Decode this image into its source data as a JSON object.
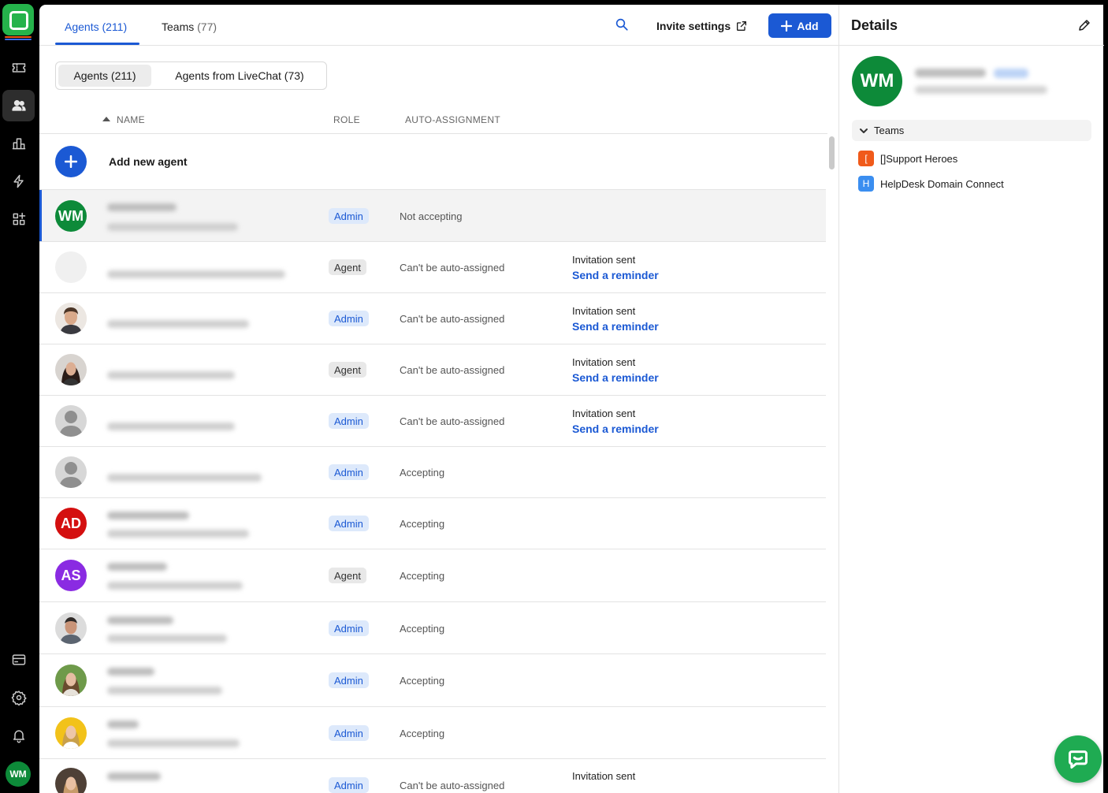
{
  "colors": {
    "accent": "#1b59d4",
    "brand_green": "#25b34b",
    "admin_badge_bg": "#dde9fb",
    "agent_badge_bg": "#e8e8e8"
  },
  "rail": {
    "items": [
      {
        "name": "tickets-icon",
        "active": false
      },
      {
        "name": "agents-icon",
        "active": true
      },
      {
        "name": "reports-icon",
        "active": false
      },
      {
        "name": "automation-icon",
        "active": false
      },
      {
        "name": "apps-icon",
        "active": false
      }
    ],
    "bottom": [
      "billing-icon",
      "settings-icon",
      "notifications-icon"
    ],
    "user_initials": "WM"
  },
  "tabs": [
    {
      "label": "Agents",
      "count": "(211)",
      "active": true
    },
    {
      "label": "Teams",
      "count": "(77)",
      "active": false
    }
  ],
  "header": {
    "invite_label": "Invite settings",
    "add_label": "Add"
  },
  "segmented": [
    {
      "label": "Agents (211)",
      "active": true
    },
    {
      "label": "Agents from LiveChat (73)",
      "active": false
    }
  ],
  "columns": {
    "name": "NAME",
    "role": "ROLE",
    "auto_assignment": "AUTO-ASSIGNMENT"
  },
  "add_agent_label": "Add new agent",
  "rows": [
    {
      "avatar": "WM",
      "avatar_color": "#0d8a39",
      "role": "Admin",
      "assignment": "Not accepting",
      "invitation": false,
      "selected": true
    },
    {
      "avatar": "",
      "avatar_color": "#f0f0f0",
      "role": "Agent",
      "assignment": "Can't be auto-assigned",
      "invitation": true
    },
    {
      "avatar": "photo-man-1",
      "role": "Admin",
      "assignment": "Can't be auto-assigned",
      "invitation": true
    },
    {
      "avatar": "photo-woman-1",
      "role": "Agent",
      "assignment": "Can't be auto-assigned",
      "invitation": true
    },
    {
      "avatar": "photo-placeholder",
      "role": "Admin",
      "assignment": "Can't be auto-assigned",
      "invitation": true
    },
    {
      "avatar": "photo-placeholder",
      "role": "Admin",
      "assignment": "Accepting",
      "invitation": false
    },
    {
      "avatar": "AD",
      "avatar_color": "#d40f0f",
      "role": "Admin",
      "assignment": "Accepting",
      "invitation": false
    },
    {
      "avatar": "AS",
      "avatar_color": "#8a2be2",
      "role": "Agent",
      "assignment": "Accepting",
      "invitation": false
    },
    {
      "avatar": "photo-man-2",
      "role": "Admin",
      "assignment": "Accepting",
      "invitation": false
    },
    {
      "avatar": "photo-woman-2",
      "role": "Admin",
      "assignment": "Accepting",
      "invitation": false
    },
    {
      "avatar": "photo-woman-3",
      "role": "Admin",
      "assignment": "Accepting",
      "invitation": false
    },
    {
      "avatar": "photo-woman-4",
      "role": "Admin",
      "assignment": "Can't be auto-assigned",
      "invitation": true
    }
  ],
  "invitation": {
    "sent_label": "Invitation sent",
    "reminder_label": "Send a reminder"
  },
  "details": {
    "title": "Details",
    "avatar": "WM",
    "teams_label": "Teams",
    "teams": [
      {
        "icon_letter": "[",
        "color": "#f05a1a",
        "name": "[]Support Heroes"
      },
      {
        "icon_letter": "H",
        "color": "#3b8ef0",
        "name": "HelpDesk Domain Connect"
      }
    ]
  }
}
